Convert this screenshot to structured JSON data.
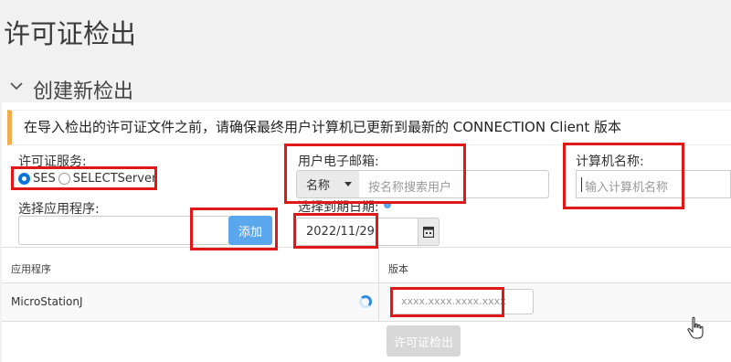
{
  "page": {
    "title": "许可证检出"
  },
  "section": {
    "title": "创建新检出"
  },
  "alert": {
    "text": "在导入检出的许可证文件之前，请确保最终用户计算机已更新到最新的 CONNECTION Client 版本"
  },
  "form": {
    "license_service": {
      "label": "许可证服务:",
      "options": [
        {
          "label": "SES",
          "selected": true
        },
        {
          "label": "SELECTServer",
          "selected": false
        }
      ]
    },
    "select_app": {
      "label": "选择应用程序:",
      "add_button": "添加"
    },
    "user_email": {
      "label": "用户电子邮箱:",
      "search_by": "名称",
      "placeholder": "按名称搜索用户"
    },
    "computer_name": {
      "label": "计算机名称:",
      "placeholder": "输入计算机名称"
    },
    "expiry_date": {
      "label": "选择到期日期:",
      "value": "2022/11/29"
    }
  },
  "table": {
    "headers": [
      "应用程序",
      "版本"
    ],
    "rows": [
      {
        "app": "MicroStationJ",
        "version_placeholder": "xxxx.xxxx.xxxx.xxxx"
      }
    ]
  },
  "checkout_button": "许可证检出",
  "colors": {
    "accent": "#0a74d8",
    "warning": "#f0ad4e",
    "annotation": "#e01818"
  }
}
